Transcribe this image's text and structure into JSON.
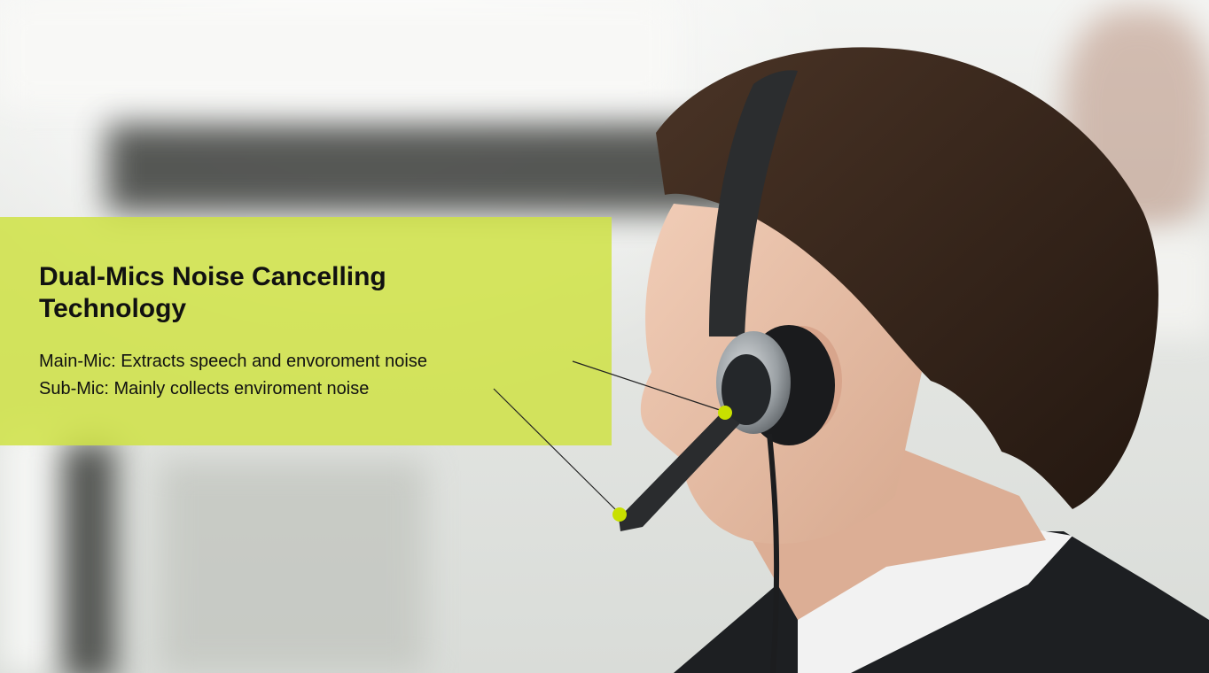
{
  "feature": {
    "title": "Dual-Mics Noise Cancelling Technology",
    "main_mic": "Main-Mic: Extracts speech and envoroment noise",
    "sub_mic": "Sub-Mic: Mainly collects enviroment noise"
  },
  "colors": {
    "accent": "#cfe246",
    "marker": "#c8e000",
    "text": "#111111"
  }
}
